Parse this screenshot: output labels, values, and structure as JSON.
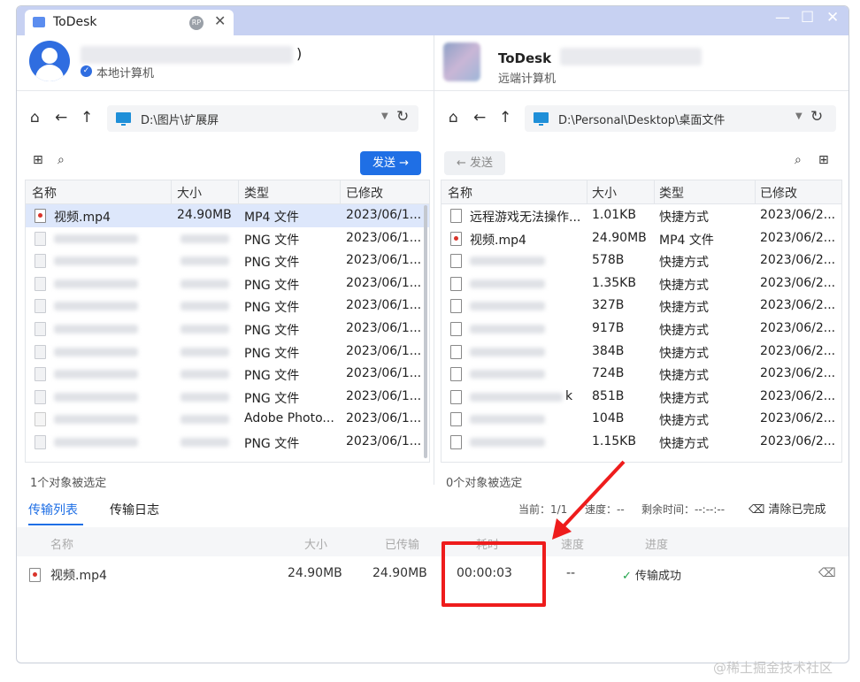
{
  "window": {
    "tab_title": "ToDesk",
    "tab_badge": "RP",
    "tab_close": "✕",
    "minimize": "—",
    "maximize": "☐",
    "close": "✕"
  },
  "local": {
    "name_suffix": ")",
    "subtitle": "本地计算机",
    "path": "D:\\图片\\扩展屏",
    "send_label": "发送 →",
    "columns": [
      "名称",
      "大小",
      "类型",
      "已修改"
    ],
    "rows": [
      {
        "name": "视频.mp4",
        "size": "24.90MB",
        "type": "MP4 文件",
        "modified": "2023/06/1...",
        "icon": "video",
        "selected": true
      },
      {
        "name": "",
        "size": "",
        "type": "PNG 文件",
        "modified": "2023/06/1...",
        "icon": "img"
      },
      {
        "name": "",
        "size": "",
        "type": "PNG 文件",
        "modified": "2023/06/1...",
        "icon": "img"
      },
      {
        "name": "",
        "size": "",
        "type": "PNG 文件",
        "modified": "2023/06/1...",
        "icon": "img"
      },
      {
        "name": "",
        "size": "",
        "type": "PNG 文件",
        "modified": "2023/06/1...",
        "icon": "img"
      },
      {
        "name": "",
        "size": "",
        "type": "PNG 文件",
        "modified": "2023/06/1...",
        "icon": "img"
      },
      {
        "name": "",
        "size": "",
        "type": "PNG 文件",
        "modified": "2023/06/1...",
        "icon": "img"
      },
      {
        "name": "",
        "size": "",
        "type": "PNG 文件",
        "modified": "2023/06/1...",
        "icon": "img"
      },
      {
        "name": "",
        "size": "",
        "type": "PNG 文件",
        "modified": "2023/06/1...",
        "icon": "img"
      },
      {
        "name": "",
        "size": "",
        "type": "Adobe Photo...",
        "modified": "2023/06/1...",
        "icon": "ps"
      },
      {
        "name": "",
        "size": "",
        "type": "PNG 文件",
        "modified": "2023/06/1...",
        "icon": "img"
      }
    ],
    "status": "1个对象被选定"
  },
  "remote": {
    "name": "ToDesk",
    "subtitle": "远端计算机",
    "path": "D:\\Personal\\Desktop\\桌面文件",
    "send_label": "← 发送",
    "columns": [
      "名称",
      "大小",
      "类型",
      "已修改"
    ],
    "rows": [
      {
        "name": "远程游戏无法操作...",
        "size": "1.01KB",
        "type": "快捷方式",
        "modified": "2023/06/2...",
        "icon": "doc"
      },
      {
        "name": "视频.mp4",
        "size": "24.90MB",
        "type": "MP4 文件",
        "modified": "2023/06/2...",
        "icon": "video"
      },
      {
        "name": "",
        "size": "578B",
        "type": "快捷方式",
        "modified": "2023/06/2...",
        "icon": "doc"
      },
      {
        "name": "",
        "size": "1.35KB",
        "type": "快捷方式",
        "modified": "2023/06/2...",
        "icon": "doc"
      },
      {
        "name": "",
        "size": "327B",
        "type": "快捷方式",
        "modified": "2023/06/2...",
        "icon": "doc"
      },
      {
        "name": "",
        "size": "917B",
        "type": "快捷方式",
        "modified": "2023/06/2...",
        "icon": "doc"
      },
      {
        "name": "",
        "size": "384B",
        "type": "快捷方式",
        "modified": "2023/06/2...",
        "icon": "doc"
      },
      {
        "name": "",
        "size": "724B",
        "type": "快捷方式",
        "modified": "2023/06/2...",
        "icon": "doc"
      },
      {
        "name": "k",
        "size": "851B",
        "type": "快捷方式",
        "modified": "2023/06/2...",
        "icon": "doc"
      },
      {
        "name": "",
        "size": "104B",
        "type": "快捷方式",
        "modified": "2023/06/2...",
        "icon": "doc"
      },
      {
        "name": "",
        "size": "1.15KB",
        "type": "快捷方式",
        "modified": "2023/06/2...",
        "icon": "doc"
      }
    ],
    "status": "0个对象被选定"
  },
  "transfer": {
    "tab_list": "传输列表",
    "tab_log": "传输日志",
    "stat_current": "当前：1/1",
    "stat_speed": "速度：--",
    "stat_remaining": "剩余时间：--:--:--",
    "clear_done": "清除已完成",
    "columns": {
      "name": "名称",
      "size": "大小",
      "transferred": "已传输",
      "time": "耗时",
      "speed": "速度",
      "progress": "进度"
    },
    "row": {
      "name": "视频.mp4",
      "size": "24.90MB",
      "transferred": "24.90MB",
      "time": "00:00:03",
      "speed": "--",
      "progress": "传输成功"
    }
  },
  "watermark": "@稀土掘金技术社区",
  "colors": {
    "accent": "#1f6fe5",
    "annotation": "#ee1c1c",
    "success": "#20a34a"
  }
}
